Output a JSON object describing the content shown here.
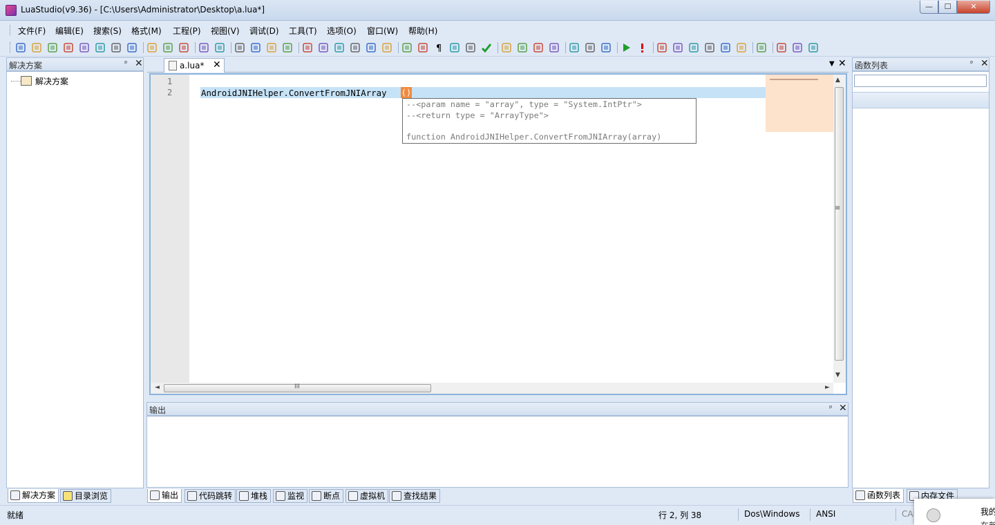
{
  "window": {
    "title": "LuaStudio(v9.36) - [C:\\Users\\Administrator\\Desktop\\a.lua*]",
    "controls": {
      "minimize": "—",
      "maximize": "☐",
      "close": "✕"
    }
  },
  "menu": [
    "文件(F)",
    "编辑(E)",
    "搜索(S)",
    "格式(M)",
    "工程(P)",
    "视图(V)",
    "调试(D)",
    "工具(T)",
    "选项(O)",
    "窗口(W)",
    "帮助(H)"
  ],
  "toolbar": {
    "icons": [
      "new-file-icon",
      "new-project-icon",
      "open-icon",
      "open-project-icon",
      "save-template-icon",
      "tree-icon",
      "save-icon",
      "save-all-icon",
      "cut-icon",
      "copy-icon",
      "paste-icon",
      "undo-icon",
      "redo-icon",
      "comment-icon",
      "uncomment-icon",
      "indent-icon",
      "outdent-icon",
      "find-icon",
      "find-next-icon",
      "find-in-files-icon",
      "replace-icon",
      "bookmark-icon",
      "bookmark-next-icon",
      "monitor-icon",
      "word-wrap-icon",
      "pilcrow-icon",
      "outline-icon",
      "structure-icon",
      "check-icon",
      "build-icon",
      "debug-icon",
      "debug-attach-icon",
      "debug-stop-icon",
      "hand-icon",
      "ruler-icon",
      "list-icon",
      "run-icon",
      "exclamation-icon",
      "step-icon",
      "step-over-icon",
      "step-into-icon",
      "step-out-icon",
      "step-back-icon",
      "breakpoint-icon",
      "properties-icon",
      "print-icon",
      "help-icon",
      "home-icon"
    ]
  },
  "left_panel": {
    "title": "解决方案",
    "pin": "ᵖ",
    "close": "✕",
    "tree_root": "解决方案",
    "tabs": [
      "解决方案",
      "目录浏览"
    ]
  },
  "editor": {
    "tab_label": "a.lua*",
    "tab_close": "✕",
    "menu_arrow": "▼",
    "close": "✕",
    "line_numbers": [
      "1",
      "2"
    ],
    "code_line": "AndroidJNIHelper.ConvertFromJNIArray",
    "paren": "()",
    "calltip": [
      "--<param name = \"array\", type = \"System.IntPtr\">",
      "--<return type = \"ArrayType\">",
      "",
      "function AndroidJNIHelper.ConvertFromJNIArray(array)"
    ],
    "scroll": {
      "up": "▲",
      "down": "▼",
      "left": "◄",
      "right": "►",
      "vgrip": "≡",
      "hgrip": "III"
    }
  },
  "output_panel": {
    "title": "输出",
    "pin": "ᵖ",
    "close": "✕",
    "tabs": [
      "输出",
      "代码跳转",
      "堆栈",
      "监视",
      "断点",
      "虚拟机",
      "查找结果"
    ]
  },
  "right_panel": {
    "title": "函数列表",
    "pin": "ᵖ",
    "close": "✕",
    "tabs": [
      "函数列表",
      "内存文件"
    ]
  },
  "statusbar": {
    "status": "就绪",
    "position": "行 2, 列 38",
    "line_ending": "Dos\\Windows",
    "encoding": "ANSI",
    "caps": "CAI"
  },
  "overlay": {
    "line1": "我的",
    "line2": "在新"
  }
}
